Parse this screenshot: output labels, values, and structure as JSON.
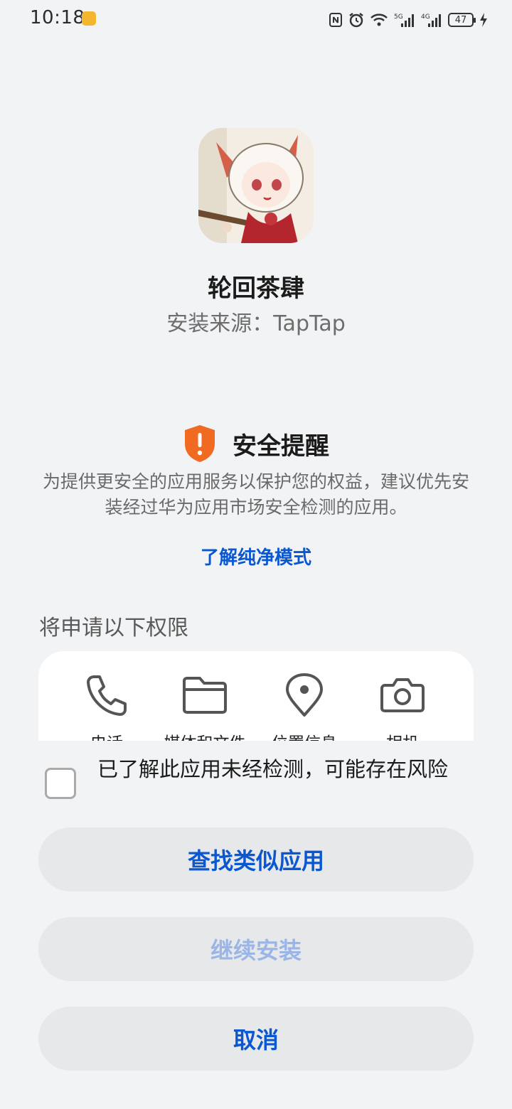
{
  "status_bar": {
    "time": "10:18",
    "battery": "47",
    "network_1": "5G",
    "network_2": "4G"
  },
  "app": {
    "name": "轮回茶肆",
    "source": "安装来源：TapTap"
  },
  "security": {
    "title": "安全提醒",
    "description": "为提供更安全的应用服务以保护您的权益，建议优先安装经过华为应用市场安全检测的应用。",
    "link": "了解纯净模式",
    "accent_color": "#f06a22"
  },
  "permissions": {
    "heading": "将申请以下权限",
    "items": [
      {
        "label": "电话",
        "icon": "phone-icon"
      },
      {
        "label": "媒体和文件",
        "icon": "folder-icon"
      },
      {
        "label": "位置信息",
        "icon": "location-icon"
      },
      {
        "label": "相机",
        "icon": "camera-icon"
      }
    ]
  },
  "consent": {
    "text": "已了解此应用未经检测，可能存在风险"
  },
  "buttons": {
    "find_similar": "查找类似应用",
    "continue_install": "继续安装",
    "cancel": "取消"
  },
  "colors": {
    "link_blue": "#0b57d0",
    "disabled_blue": "#9bb6e6",
    "background": "#f1f3f5"
  }
}
